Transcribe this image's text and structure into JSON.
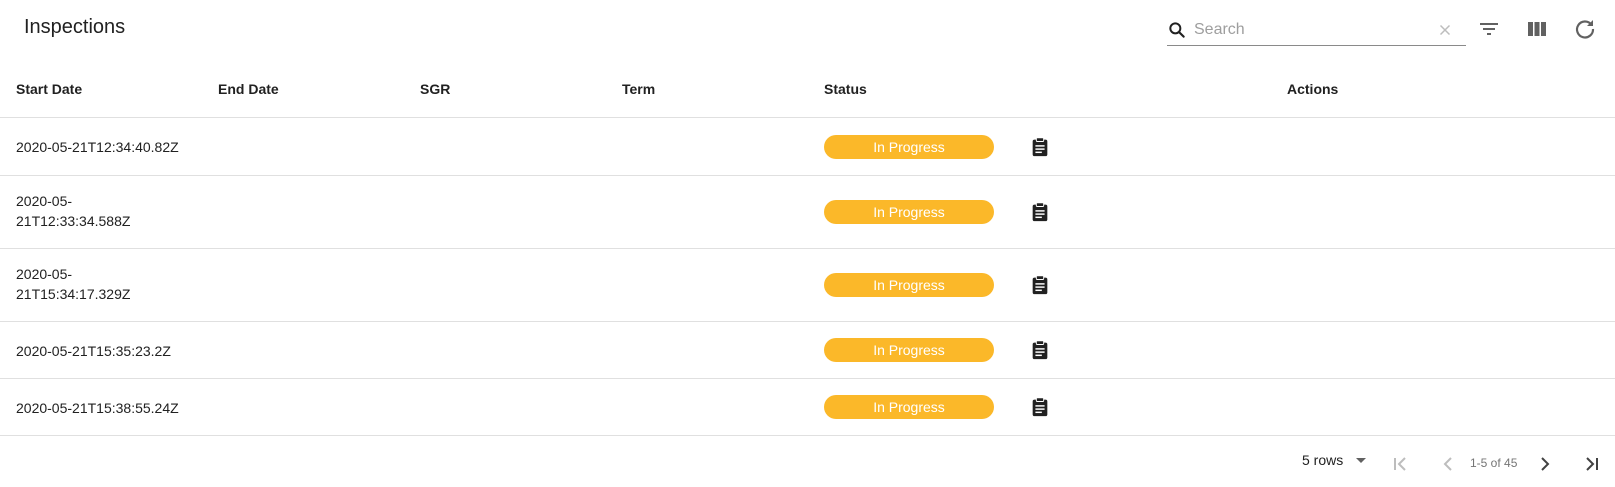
{
  "header": {
    "title": "Inspections",
    "search": {
      "placeholder": "Search",
      "value": ""
    },
    "tools": [
      "filter-icon",
      "view-column-icon",
      "refresh-icon"
    ]
  },
  "table": {
    "columns": [
      "Start Date",
      "End Date",
      "SGR",
      "Term",
      "Status",
      "Actions"
    ],
    "rows": [
      {
        "start_date": "2020-05-21T12:34:40.82Z",
        "status": "In Progress",
        "action_icon": "clipboard-icon"
      },
      {
        "start_date": "2020-05-21T12:33:34.588Z",
        "status": "In Progress",
        "action_icon": "clipboard-icon"
      },
      {
        "start_date": "2020-05-21T15:34:17.329Z",
        "status": "In Progress",
        "action_icon": "clipboard-icon"
      },
      {
        "start_date": "2020-05-21T15:35:23.2Z",
        "status": "In Progress",
        "action_icon": "clipboard-icon"
      },
      {
        "start_date": "2020-05-21T15:38:55.24Z",
        "status": "In Progress",
        "action_icon": "clipboard-icon"
      }
    ]
  },
  "pagination": {
    "rows_per_page": "5 rows",
    "range": "1-5 of 45"
  },
  "colors": {
    "status_in_progress": "#fbb829",
    "icon": "#212121",
    "icon_muted": "#757575",
    "divider": "#e0e0e0"
  }
}
